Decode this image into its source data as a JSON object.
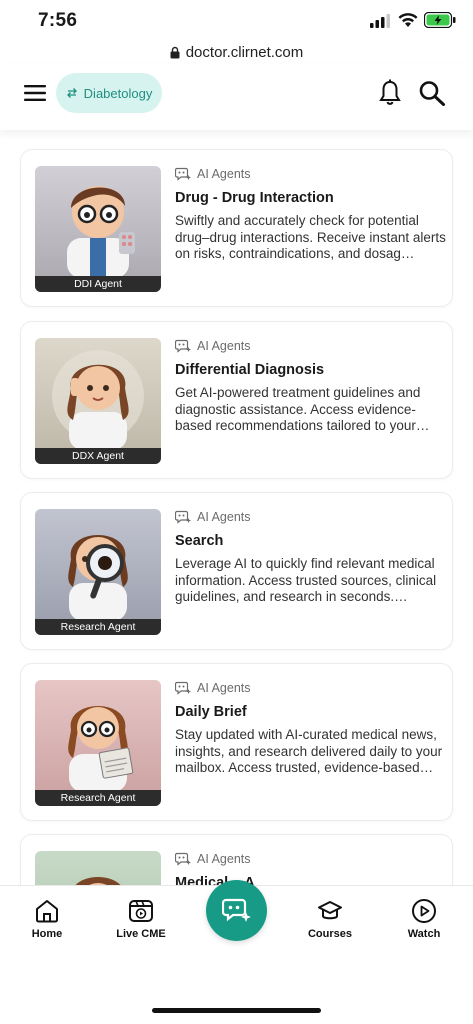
{
  "status_bar": {
    "time": "7:56"
  },
  "browser": {
    "url": "doctor.clirnet.com"
  },
  "header": {
    "specialty": "Diabetology"
  },
  "agents": [
    {
      "tag": "AI Agents",
      "title": "Drug - Drug Interaction",
      "description": "Swiftly and accurately check for potential drug–drug interactions. Receive instant alerts on risks, contraindications, and dosag…",
      "thumb_caption": "DDI Agent",
      "thumb_bg": "#b9b6bd"
    },
    {
      "tag": "AI Agents",
      "title": "Differential Diagnosis",
      "description": "Get AI-powered treatment guidelines and diagnostic assistance. Access evidence-based recommendations tailored to your patient's…",
      "thumb_caption": "DDX Agent",
      "thumb_bg": "#c9c2b3"
    },
    {
      "tag": "AI Agents",
      "title": "Search",
      "description": "Leverage AI to quickly find relevant medical information. Access trusted sources, clinical guidelines, and research in seconds. Streaml…",
      "thumb_caption": "Research Agent",
      "thumb_bg": "#a9adbb"
    },
    {
      "tag": "AI Agents",
      "title": "Daily Brief",
      "description": "Stay updated with AI-curated medical news, insights, and research delivered daily to your mailbox. Access trusted, evidence-based inf…",
      "thumb_caption": "Research Agent",
      "thumb_bg": "#dcb8b8"
    },
    {
      "tag": "AI Agents",
      "title": "Medical ...A",
      "description": "",
      "thumb_caption": "",
      "thumb_bg": "#b7cdb7"
    }
  ],
  "bottom_nav": {
    "home": "Home",
    "live_cme": "Live CME",
    "courses": "Courses",
    "watch": "Watch"
  },
  "colors": {
    "accent": "#179b86",
    "chip_bg": "#d6f3ef",
    "chip_text": "#1f8f80"
  }
}
